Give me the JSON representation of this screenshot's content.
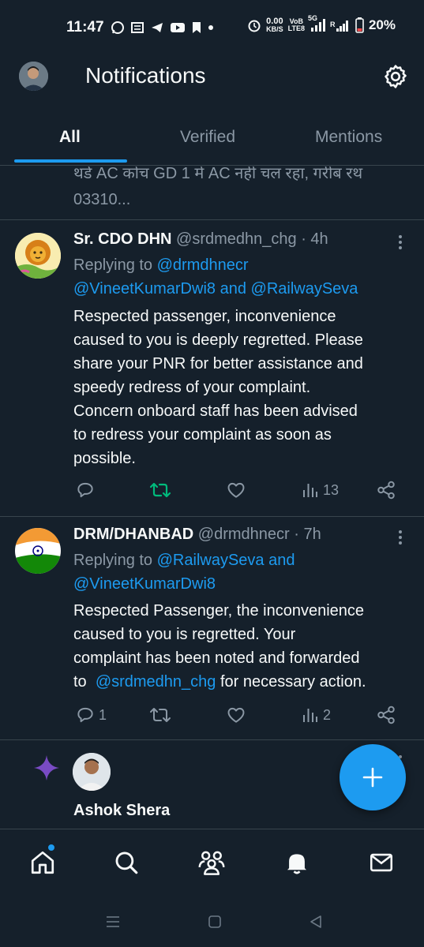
{
  "status_bar": {
    "time": "11:47",
    "net_speed_top": "0.00",
    "net_speed_bottom": "KB/S",
    "volte_top": "VoB",
    "volte_bottom": "LTE8",
    "network": "5G",
    "battery": "20%"
  },
  "header": {
    "title": "Notifications"
  },
  "tabs": [
    {
      "label": "All",
      "active": true
    },
    {
      "label": "Verified",
      "active": false
    },
    {
      "label": "Mentions",
      "active": false
    }
  ],
  "partial_tweet": {
    "line1": "थर्ड AC कोच GD 1 में AC नहीं चल रहा, गरीब रथ",
    "line2": "03310..."
  },
  "tweets": [
    {
      "name": "Sr. CDO DHN",
      "handle": "@srdmedhn_chg",
      "time": "· 4h",
      "replying_prefix": "Replying to",
      "reply_to_1": "@drmdhnecr",
      "reply_to_2": "@VineetKumarDwi8",
      "reply_and": "and",
      "reply_to_3": "@RailwaySeva",
      "body_lines": [
        "Respected passenger, inconvenience",
        "caused to you is deeply regretted. Please",
        "share your PNR for better assistance and",
        "speedy redress of your complaint.",
        "Concern onboard staff has been advised",
        "to redress your complaint as soon as",
        "possible."
      ],
      "replies": "",
      "views": "13",
      "retweeted": true
    },
    {
      "name": "DRM/DHANBAD",
      "handle": "@drmdhnecr",
      "time": "· 7h",
      "replying_prefix": "Replying to",
      "reply_to_1": "@RailwaySeva",
      "reply_and": "and",
      "reply_to_2": "@VineetKumarDwi8",
      "body_lines": [
        "Respected Passenger, the inconvenience",
        "caused to you is regretted. Your",
        "complaint has been noted and forwarded"
      ],
      "body_last_prefix": "to",
      "body_last_mention": "@srdmedhn_chg",
      "body_last_suffix": "for necessary action.",
      "replies": "1",
      "views": "2",
      "retweeted": false
    }
  ],
  "suggestion": {
    "name": "Ashok Shera"
  },
  "bottom_nav": [
    "home-icon",
    "search-icon",
    "communities-icon",
    "notifications-icon",
    "messages-icon"
  ],
  "colors": {
    "background": "#15202b",
    "accent": "#1d9bf0",
    "muted": "#8b98a5",
    "retweet": "#00ba7c",
    "sparkle": "#794bc4"
  }
}
